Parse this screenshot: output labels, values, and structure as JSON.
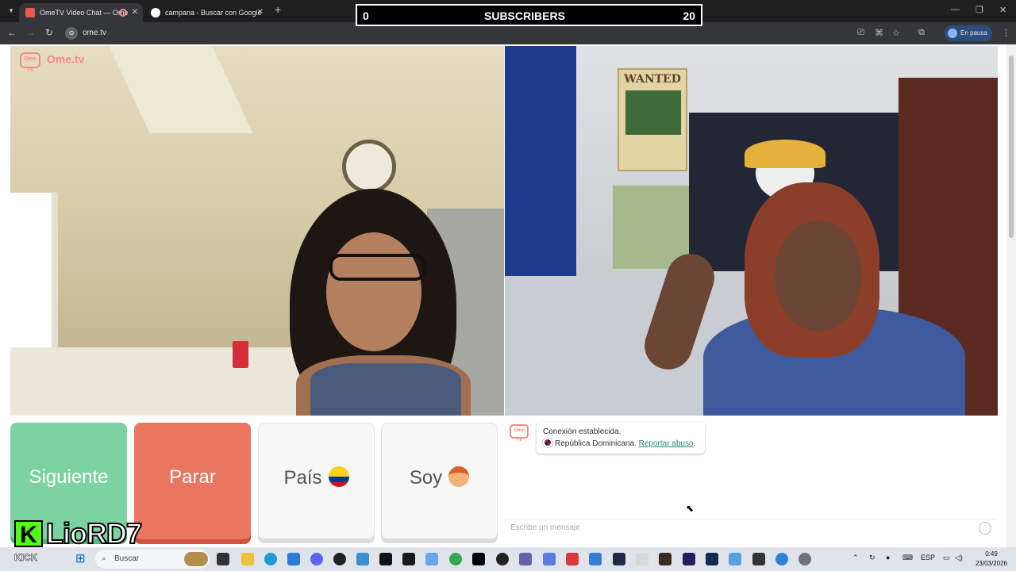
{
  "browser": {
    "tabs": [
      {
        "label": "OmeTV Video Chat — Ome",
        "active": true
      },
      {
        "label": "campana - Buscar con Google",
        "active": false
      }
    ],
    "url": "ome.tv",
    "profile_status": "En pausa",
    "site_icon_glyph": "⊙"
  },
  "overlay": {
    "left_count": "0",
    "title": "SUBSCRIBERS",
    "right_count": "20"
  },
  "brand": {
    "logo_bubble": "Ome TV",
    "logo_text": "Ome.tv",
    "accent_color": "#f28b82"
  },
  "poster": {
    "wanted_text": "WANTED"
  },
  "actions": {
    "next_label": "Siguiente",
    "stop_label": "Parar",
    "country_label": "País",
    "country_icon": "colombia-flag-icon",
    "me_label": "Soy",
    "me_icon": "boy-emoji-icon"
  },
  "chat": {
    "logo": "Ome TV",
    "status_line": "Conexión establecida.",
    "country_line": "República Dominicana.",
    "report_link": "Reportar abuso",
    "report_suffix": ".",
    "input_placeholder": "Escribe un mensaje"
  },
  "streamer": {
    "badge_letter": "K",
    "name": "LioRD7",
    "platform": "KICK",
    "brand_color": "#53fc18"
  },
  "taskbar": {
    "search_placeholder": "Buscar",
    "language": "ESP",
    "time": "0:49",
    "date": "23/03/2026"
  }
}
